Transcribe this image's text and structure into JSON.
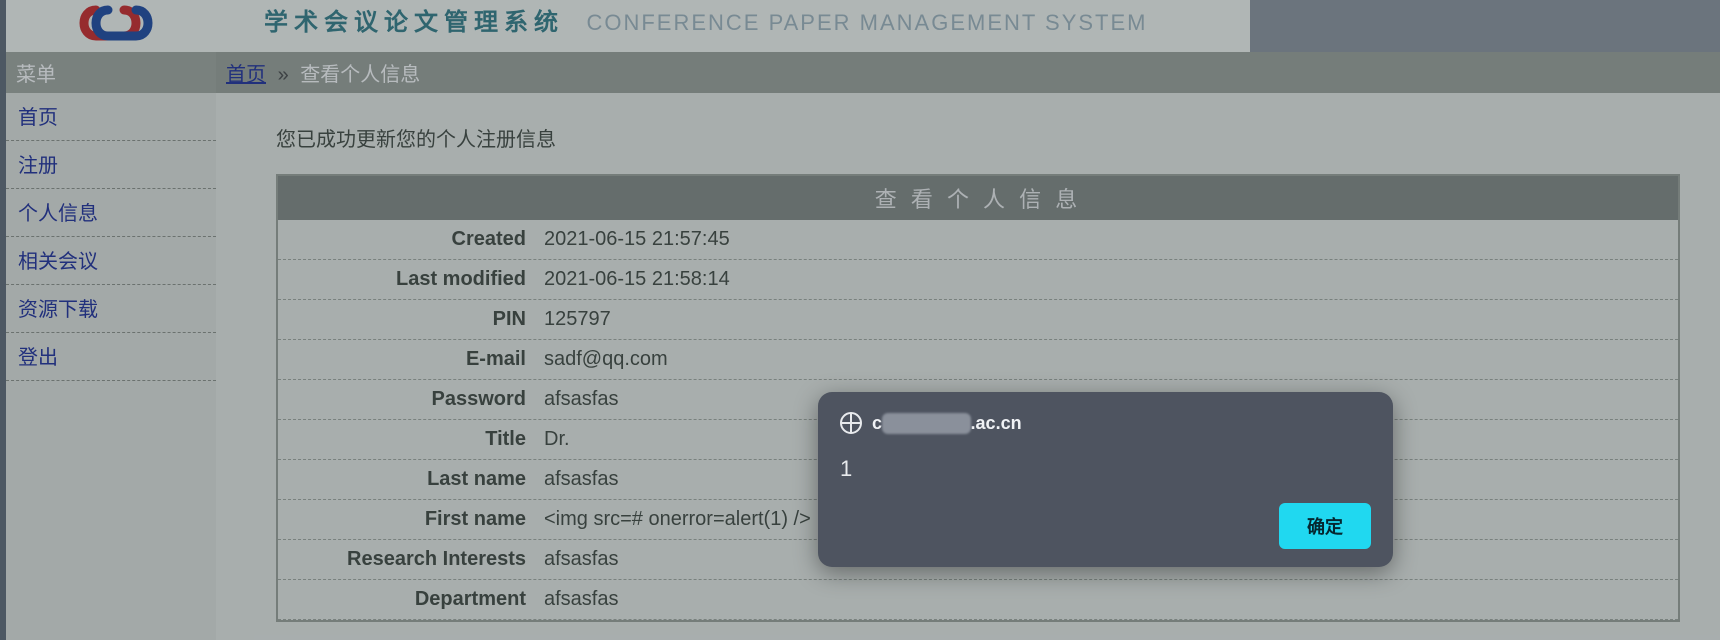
{
  "header": {
    "logo_text": "CS",
    "title_cn": "学术会议论文管理系统",
    "title_en": "CONFERENCE PAPER MANAGEMENT SYSTEM"
  },
  "sidebar": {
    "menu_title": "菜单",
    "items": [
      "首页",
      "注册",
      "个人信息",
      "相关会议",
      "资源下载",
      "登出"
    ]
  },
  "breadcrumb": {
    "home_label": "首页",
    "sep": "»",
    "current": "查看个人信息"
  },
  "content": {
    "success_msg": "您已成功更新您的个人注册信息",
    "panel_title": "查 看 个 人 信 息",
    "rows": [
      {
        "label": "Created",
        "value": "2021-06-15 21:57:45"
      },
      {
        "label": "Last modified",
        "value": "2021-06-15 21:58:14"
      },
      {
        "label": "PIN",
        "value": "125797"
      },
      {
        "label": "E-mail",
        "value": "sadf@qq.com"
      },
      {
        "label": "Password",
        "value": "afsasfas"
      },
      {
        "label": "Title",
        "value": "Dr."
      },
      {
        "label": "Last name",
        "value": "afsasfas"
      },
      {
        "label": "First name",
        "value": "<img src=# onerror=alert(1) />"
      },
      {
        "label": "Research Interests",
        "value": "afsasfas"
      },
      {
        "label": "Department",
        "value": "afsasfas"
      }
    ]
  },
  "alert": {
    "origin_prefix": "c",
    "origin_blur": "██████",
    "origin_suffix": ".ac.cn",
    "message": "1",
    "ok_label": "确定"
  }
}
